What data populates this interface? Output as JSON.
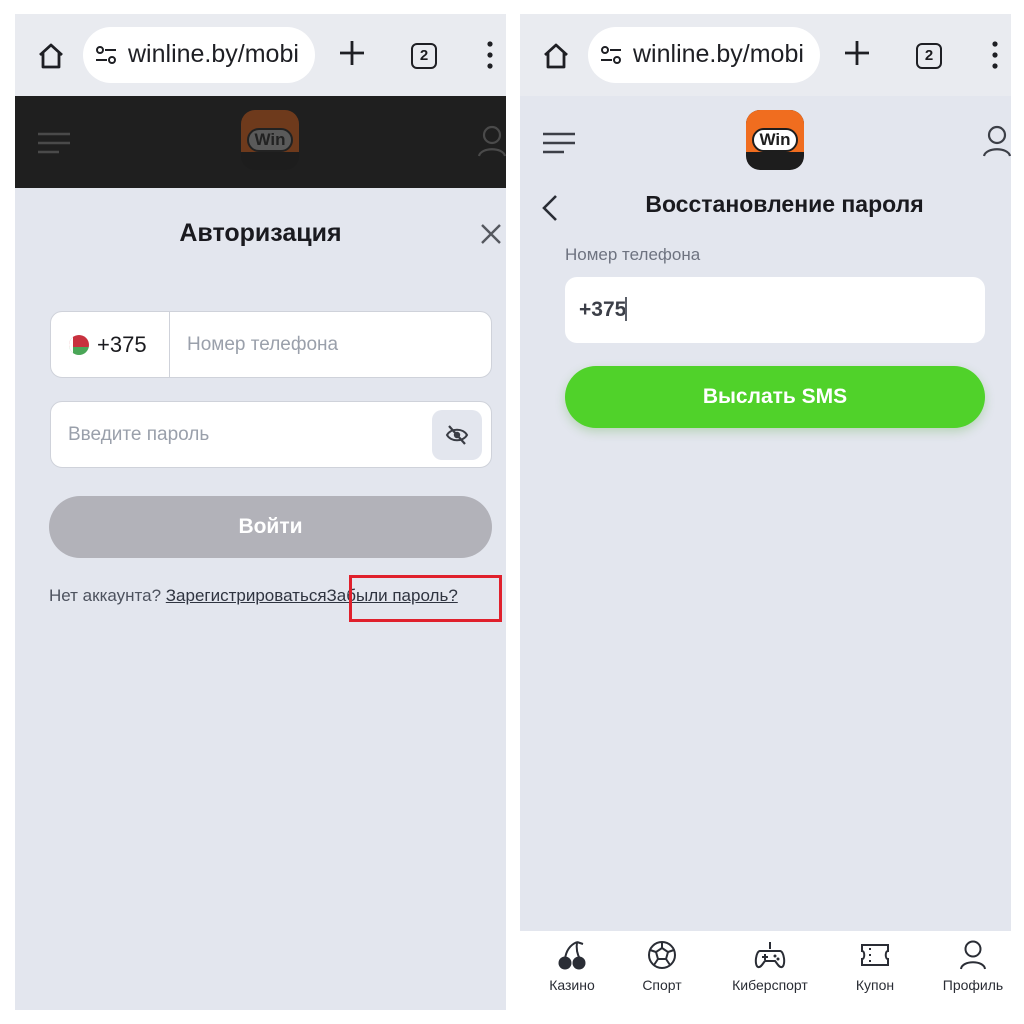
{
  "browser": {
    "url": "winline.by/mobi",
    "tab_count": "2"
  },
  "site": {
    "logo_text": "Win"
  },
  "login_modal": {
    "title": "Авторизация",
    "country_code": "+375",
    "phone_placeholder": "Номер телефона",
    "password_placeholder": "Введите пароль",
    "login_button": "Войти",
    "no_account_text": "Нет аккаунта?",
    "register_link": "Зарегистрироваться",
    "forgot_link": "Забыли пароль?"
  },
  "recovery": {
    "title": "Восстановление пароля",
    "phone_label": "Номер телефона",
    "phone_value": "+375",
    "send_sms_button": "Выслать SMS"
  },
  "bottom_nav": {
    "items": [
      {
        "label": "Казино",
        "icon": "cherry-icon"
      },
      {
        "label": "Спорт",
        "icon": "soccer-ball-icon"
      },
      {
        "label": "Киберспорт",
        "icon": "gamepad-icon"
      },
      {
        "label": "Купон",
        "icon": "ticket-icon"
      },
      {
        "label": "Профиль",
        "icon": "user-icon"
      }
    ]
  },
  "colors": {
    "accent_green": "#50d22a",
    "brand_orange": "#f06d1f",
    "highlight_red": "#e0202c",
    "disabled_button": "#b2b2b9"
  }
}
